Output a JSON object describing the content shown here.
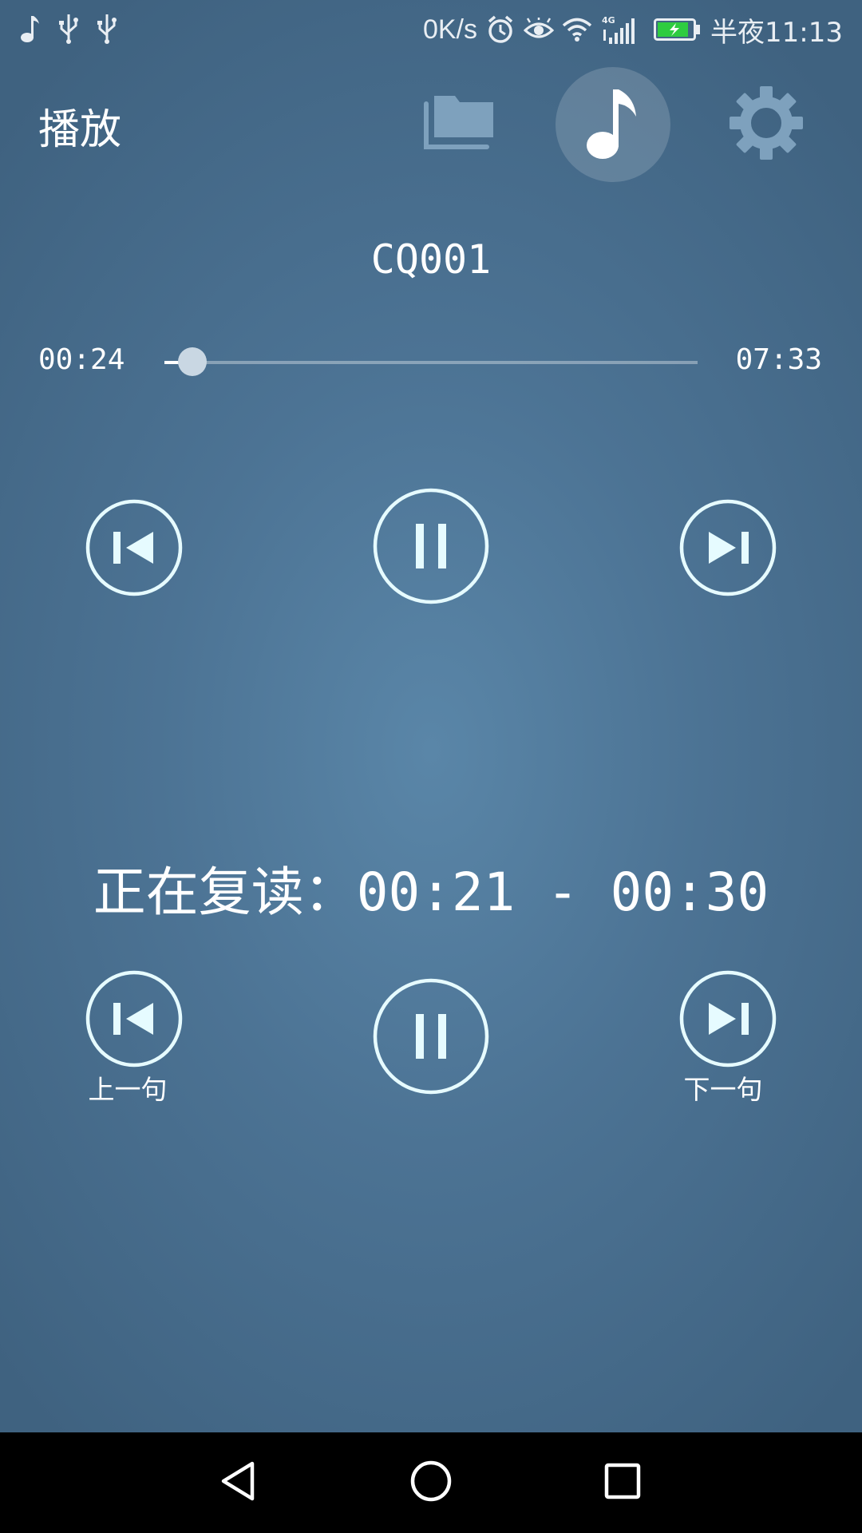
{
  "status_bar": {
    "left_icons": [
      "music-note-icon",
      "usb-icon",
      "usb-icon"
    ],
    "net_speed": "0K/s",
    "right_icons": [
      "alarm-icon",
      "eye-icon",
      "wifi-icon",
      "signal-4g-icon",
      "battery-charging-icon"
    ],
    "network_type": "4G",
    "time": "半夜11:13",
    "battery_color": "#2ecc40"
  },
  "header": {
    "title": "播放",
    "tabs": [
      {
        "icon": "folder-icon",
        "active": false
      },
      {
        "icon": "music-note-icon",
        "active": true
      },
      {
        "icon": "gear-icon",
        "active": false
      }
    ]
  },
  "player": {
    "track_title": "CQ001",
    "current_time": "00:24",
    "total_time": "07:33",
    "progress": 0.053,
    "controls": [
      "previous-track-icon",
      "pause-icon",
      "next-track-icon"
    ]
  },
  "repeat": {
    "prefix": "正在复读：",
    "range": "00:21 - 00:30",
    "prev_label": "上一句",
    "next_label": "下一句",
    "controls": [
      "previous-sentence-icon",
      "pause-icon",
      "next-sentence-icon"
    ]
  },
  "nav_bar": {
    "buttons": [
      "back-icon",
      "home-icon",
      "recents-icon"
    ]
  },
  "colors": {
    "background": "#4c7394",
    "icon_stroke": "#e6fbff",
    "accent_active": "#ffffff"
  }
}
